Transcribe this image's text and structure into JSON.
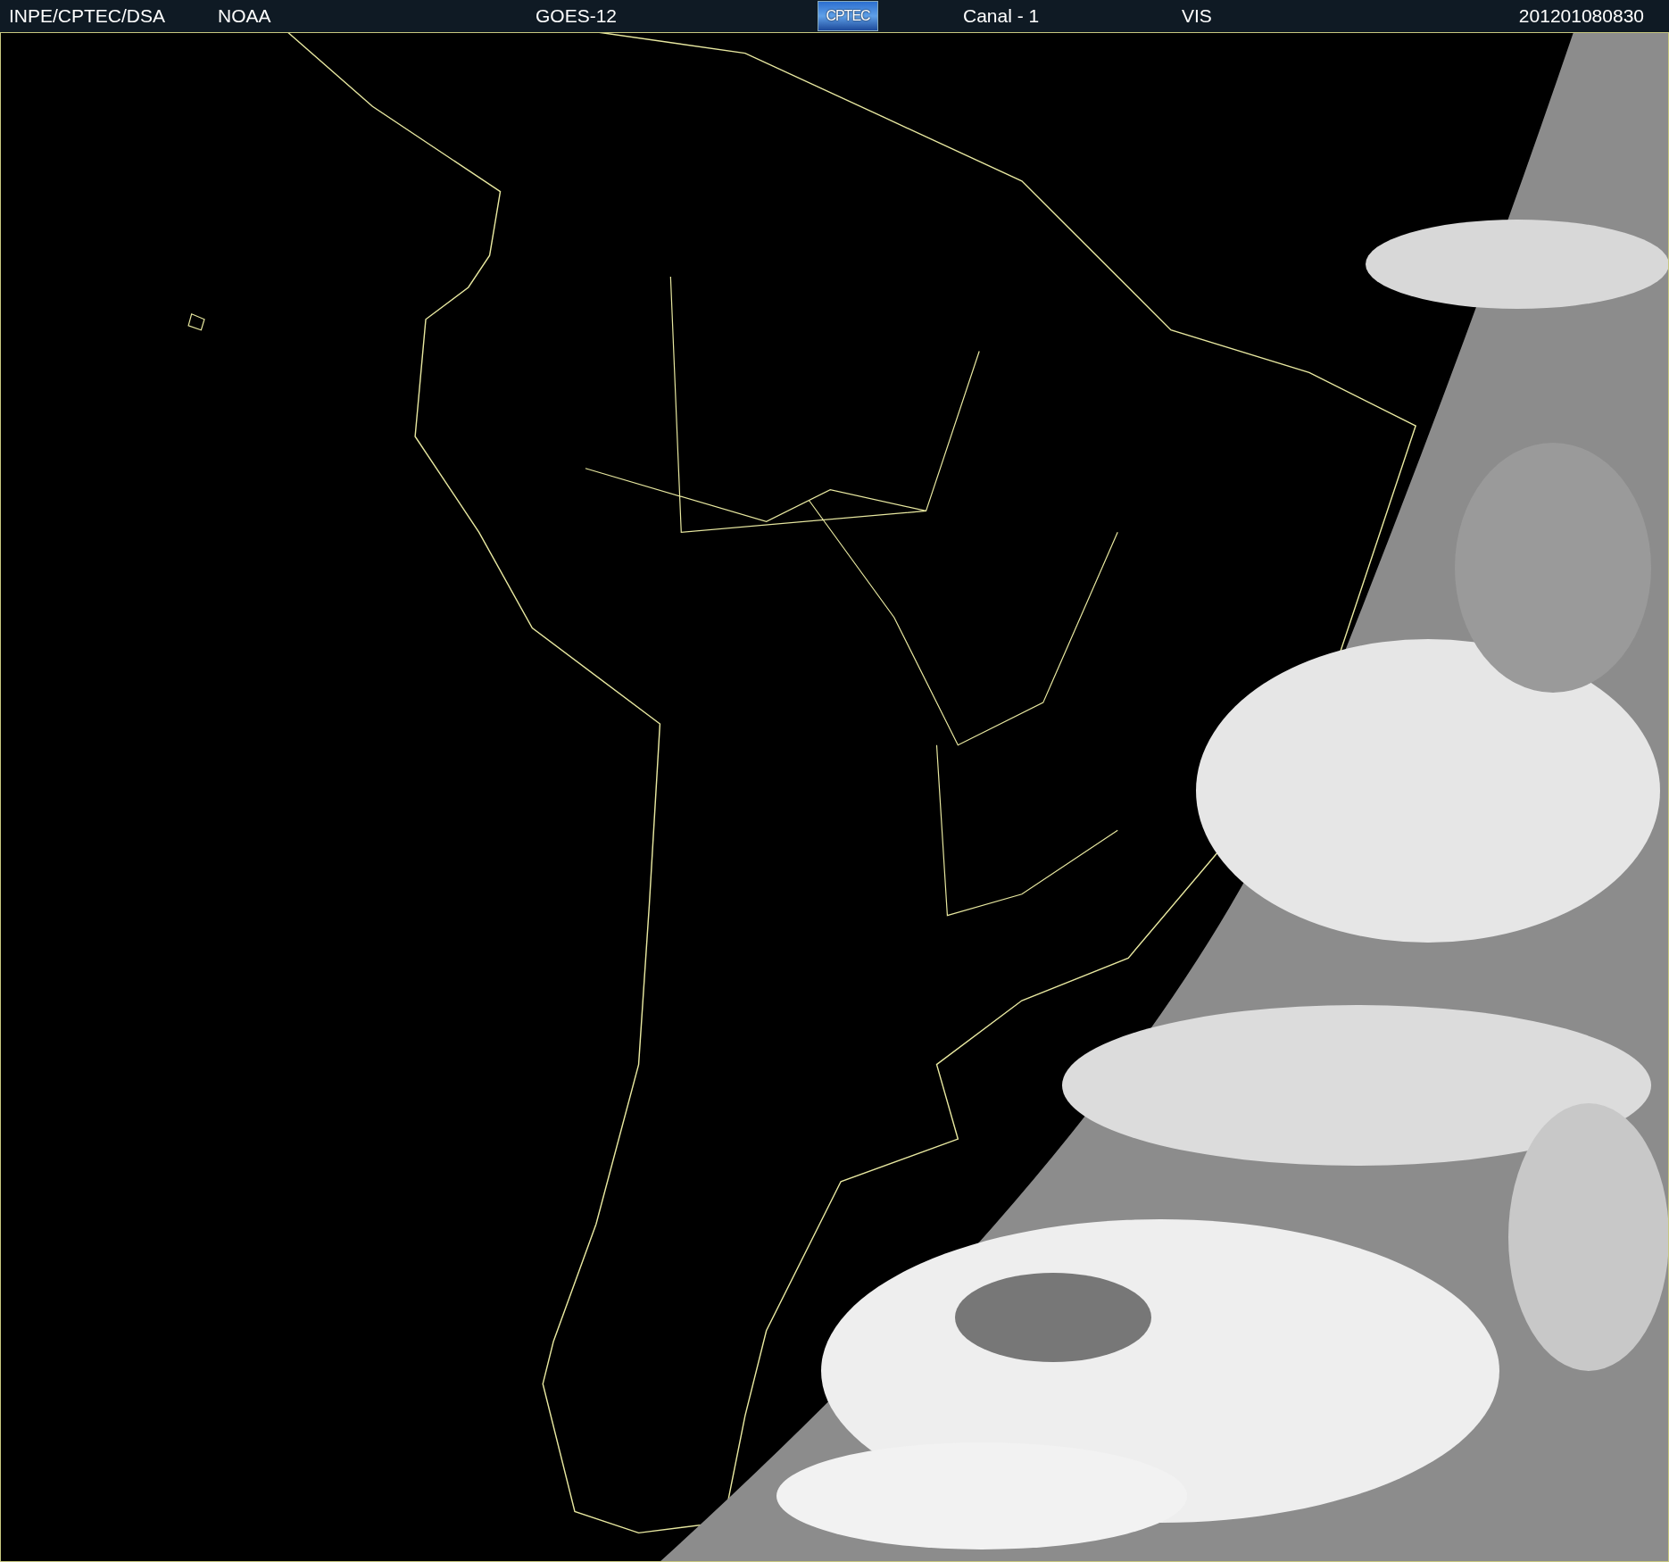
{
  "header": {
    "items": [
      {
        "kind": "text",
        "text": "INPE/CPTEC/DSA"
      },
      {
        "kind": "text",
        "text": "NOAA"
      },
      {
        "kind": "text",
        "text": "GOES-12"
      },
      {
        "kind": "logo",
        "text": "CPTEC"
      },
      {
        "kind": "text",
        "text": "Canal - 1"
      },
      {
        "kind": "text",
        "text": "VIS"
      },
      {
        "kind": "text",
        "text": "201201080830"
      }
    ]
  }
}
